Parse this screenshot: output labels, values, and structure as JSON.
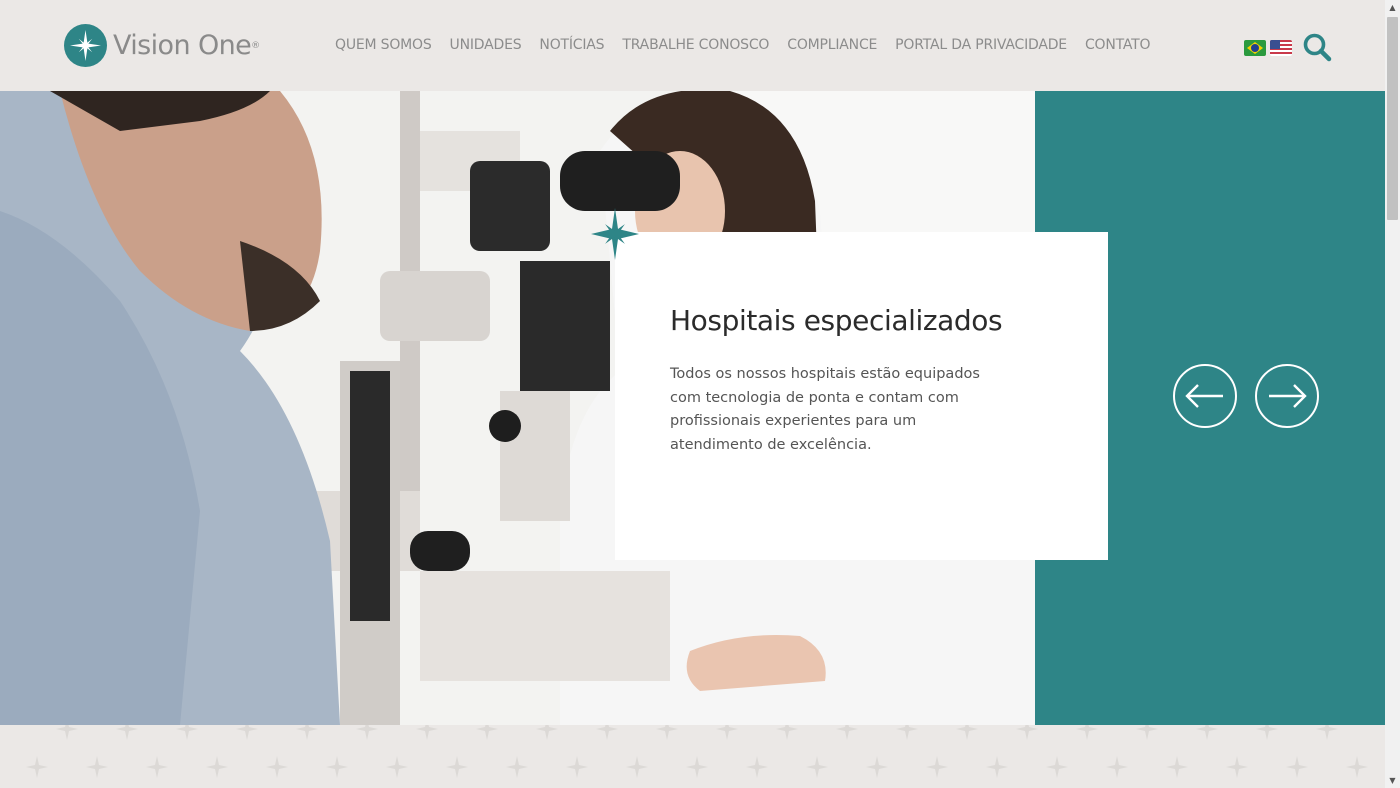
{
  "header": {
    "logo_text": "Vision One",
    "logo_mark": "®",
    "nav": [
      {
        "label": "QUEM SOMOS"
      },
      {
        "label": "UNIDADES"
      },
      {
        "label": "NOTÍCIAS"
      },
      {
        "label": "TRABALHE CONOSCO"
      },
      {
        "label": "COMPLIANCE"
      },
      {
        "label": "PORTAL DA PRIVACIDADE"
      },
      {
        "label": "CONTATO"
      }
    ],
    "flags": [
      "brazil-flag-icon",
      "usa-flag-icon"
    ],
    "search_icon": "search-icon"
  },
  "hero": {
    "title": "Hospitais especializados",
    "text": "Todos os nossos hospitais estão equipados com tecnologia de ponta e contam com profissionais experientes para um atendimento de excelência.",
    "prev_icon": "arrow-left-icon",
    "next_icon": "arrow-right-icon"
  },
  "colors": {
    "brand_teal": "#2e8587",
    "background": "#ebe8e6",
    "nav_text": "#8c8c8c"
  }
}
